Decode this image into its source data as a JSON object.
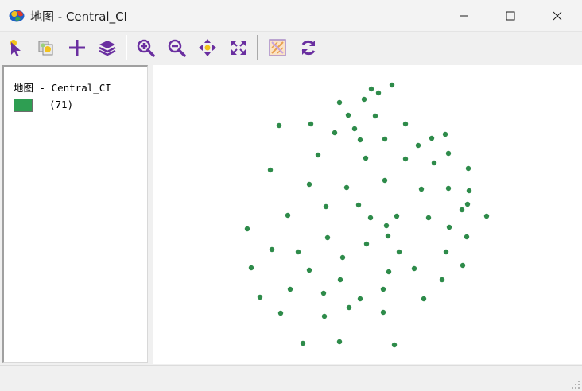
{
  "window": {
    "title": "地图 - Central_CI"
  },
  "toolbar": {
    "buttons": [
      {
        "name": "select-tool-icon"
      },
      {
        "name": "identify-tool-icon"
      },
      {
        "name": "add-layer-icon"
      },
      {
        "name": "layers-icon"
      },
      {
        "name": "zoom-in-icon"
      },
      {
        "name": "zoom-out-icon"
      },
      {
        "name": "pan-icon"
      },
      {
        "name": "full-extent-icon"
      },
      {
        "name": "clear-selection-icon"
      },
      {
        "name": "refresh-icon"
      }
    ]
  },
  "legend": {
    "layer_title": "地图 - Central_CI",
    "count_label": "(71)",
    "swatch_color": "#2e9e52"
  },
  "map": {
    "point_color": "#2e8b4a",
    "point_count": 71
  }
}
